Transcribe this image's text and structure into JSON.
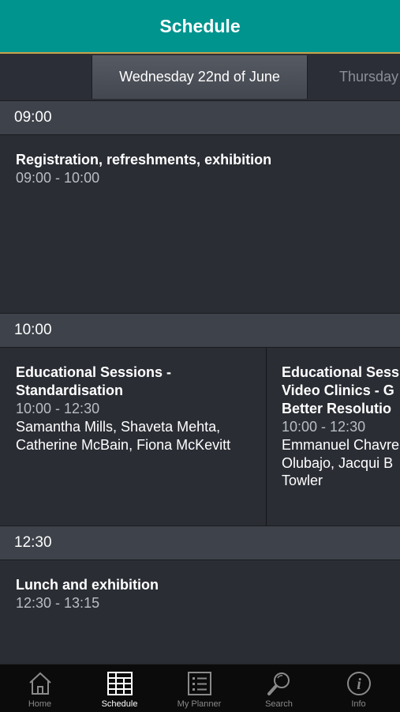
{
  "header": {
    "title": "Schedule"
  },
  "day_tabs": [
    {
      "label": "Wednesday 22nd of June",
      "selected": true
    },
    {
      "label": "Thursday",
      "selected": false
    }
  ],
  "timeslots": [
    {
      "time": "09:00",
      "sessions": [
        {
          "title": "Registration, refreshments, exhibition",
          "time": "09:00 - 10:00",
          "speakers": ""
        }
      ]
    },
    {
      "time": "10:00",
      "sessions": [
        {
          "title": "Educational Sessions - Standardisation",
          "time": "10:00 - 12:30",
          "speakers": "Samantha Mills, Shaveta Mehta, Catherine McBain, Fiona McKevitt"
        },
        {
          "title": "Educational Sess Video Clinics - G Better Resolutio",
          "time": "10:00 - 12:30",
          "speakers": "Emmanuel Chavre Olubajo, Jacqui B Towler"
        }
      ]
    },
    {
      "time": "12:30",
      "sessions": [
        {
          "title": "Lunch and exhibition",
          "time": "12:30 - 13:15",
          "speakers": ""
        }
      ]
    }
  ],
  "tabbar": {
    "items": [
      {
        "label": "Home",
        "icon": "home-icon",
        "active": false
      },
      {
        "label": "Schedule",
        "icon": "schedule-grid-icon",
        "active": true
      },
      {
        "label": "My Planner",
        "icon": "planner-list-icon",
        "active": false
      },
      {
        "label": "Search",
        "icon": "search-icon",
        "active": false
      },
      {
        "label": "Info",
        "icon": "info-icon",
        "active": false
      }
    ]
  },
  "colors": {
    "header_bg": "#00948f",
    "accent_line": "#c9a24a",
    "background": "#2a2d34",
    "time_header_bg": "#3e424a",
    "tabbar_bg": "#0b0b0b"
  }
}
